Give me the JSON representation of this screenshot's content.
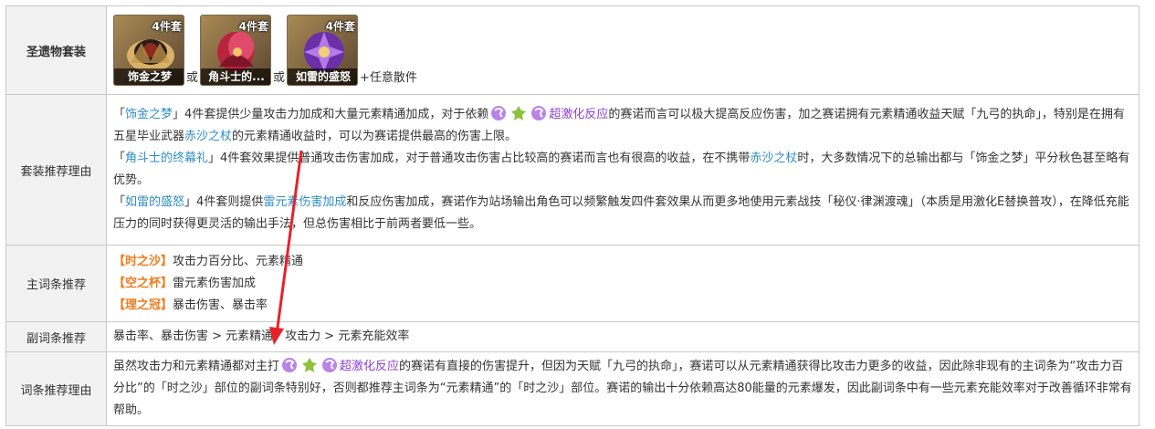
{
  "rows": {
    "set": {
      "header": "圣遗物套装",
      "cards": [
        {
          "tag": "4件套",
          "name": "饰金之梦"
        },
        {
          "tag": "4件套",
          "name": "角斗士的..."
        },
        {
          "tag": "4件套",
          "name": "如雷的盛怒"
        }
      ],
      "or": "或",
      "tail": "+任意散件"
    },
    "reason": {
      "header": "套装推荐理由",
      "p1": {
        "open": "「",
        "set": "饰金之梦",
        "close": "」",
        "a": "4件套提供少量攻击力加成和大量元素精通加成，对于依赖",
        "reaction": "超激化反应",
        "b": "的赛诺而言可以极大提高反应伤害，加之赛诺拥有元素精通收益天赋「九弓的执命」，特别是在拥有五星毕业武器",
        "weapon": "赤沙之杖",
        "c": "的元素精通收益时，可以为赛诺提供最高的伤害上限。"
      },
      "p2": {
        "open": "「",
        "set": "角斗士的终幕礼",
        "close": "」",
        "a": "4件套效果提供普通攻击伤害加成，对于普通攻击伤害占比较高的赛诺而言也有很高的收益，在不携带",
        "weapon": "赤沙之杖",
        "b": "时，大多数情况下的总输出都与「饰金之梦」平分秋色甚至略有优势。"
      },
      "p3": {
        "open": "「",
        "set": "如雷的盛怒",
        "close": "」",
        "a": "4件套则提供",
        "bonus": "雷元素伤害加成",
        "b": "和反应伤害加成，赛诺作为站场输出角色可以频繁触发四件套效果从而更多地使用元素战技「秘仪·律渊渡魂」（本质是用激化E替换普攻），在降低充能压力的同时获得更灵活的输出手法，但总伤害相比于前两者要低一些。"
      }
    },
    "main": {
      "header": "主词条推荐",
      "items": [
        {
          "slot": "【时之沙】",
          "value": "攻击力百分比、元素精通"
        },
        {
          "slot": "【空之杯】",
          "value": "雷元素伤害加成"
        },
        {
          "slot": "【理之冠】",
          "value": "暴击伤害、暴击率"
        }
      ]
    },
    "sub": {
      "header": "副词条推荐",
      "value": "暴击率、暴击伤害 > 元素精通、攻击力 > 元素充能效率"
    },
    "subreason": {
      "header": "词条推荐理由",
      "a": "虽然攻击力和元素精通都对主打",
      "reaction": "超激化反应",
      "b": "的赛诺有直接的伤害提升，但因为天赋「九弓的执命」，赛诺可以从元素精通获得比攻击力更多的收益，因此除非现有的主词条为“攻击力百分比”的「时之沙」部位的副词条特别好，否则都推荐主词条为“元素精通”的「时之沙」部位。赛诺的输出十分依赖高达80能量的元素爆发，因此副词条中有一些元素充能效率对于改善循环非常有帮助。"
    }
  },
  "colors": {
    "link": "#2d8dc6",
    "reaction": "#8b3fd6",
    "slot": "#ef7c1d",
    "arrow": "#e8212a"
  }
}
